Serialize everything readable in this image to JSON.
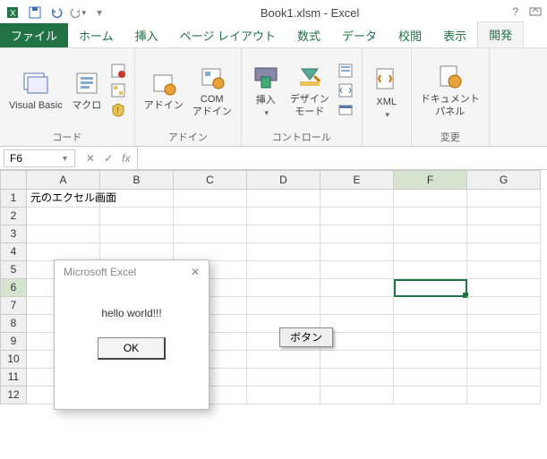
{
  "title": "Book1.xlsm - Excel",
  "tabs": {
    "file": "ファイル",
    "home": "ホーム",
    "insert": "挿入",
    "pagelayout": "ページ レイアウト",
    "formulas": "数式",
    "data": "データ",
    "review": "校閲",
    "view": "表示",
    "developer": "開発"
  },
  "ribbon": {
    "vb": "Visual Basic",
    "macro": "マクロ",
    "addins": "アドイン",
    "comaddins": "COM\nアドイン",
    "insert": "挿入",
    "design": "デザイン\nモード",
    "xml": "XML",
    "docpanel": "ドキュメント\nパネル",
    "group_code": "コード",
    "group_addins": "アドイン",
    "group_controls": "コントロール",
    "group_change": "変更"
  },
  "namebox": "F6",
  "fx_label": "fx",
  "columns": [
    "A",
    "B",
    "C",
    "D",
    "E",
    "F",
    "G"
  ],
  "rows": [
    "1",
    "2",
    "3",
    "4",
    "5",
    "6",
    "7",
    "8",
    "9",
    "10",
    "11",
    "12"
  ],
  "cell_a1": "元のエクセル画面",
  "selected_col": "F",
  "selected_row": "6",
  "button_label": "ボタン",
  "dialog": {
    "title": "Microsoft Excel",
    "message": "hello world!!!",
    "ok": "OK"
  }
}
